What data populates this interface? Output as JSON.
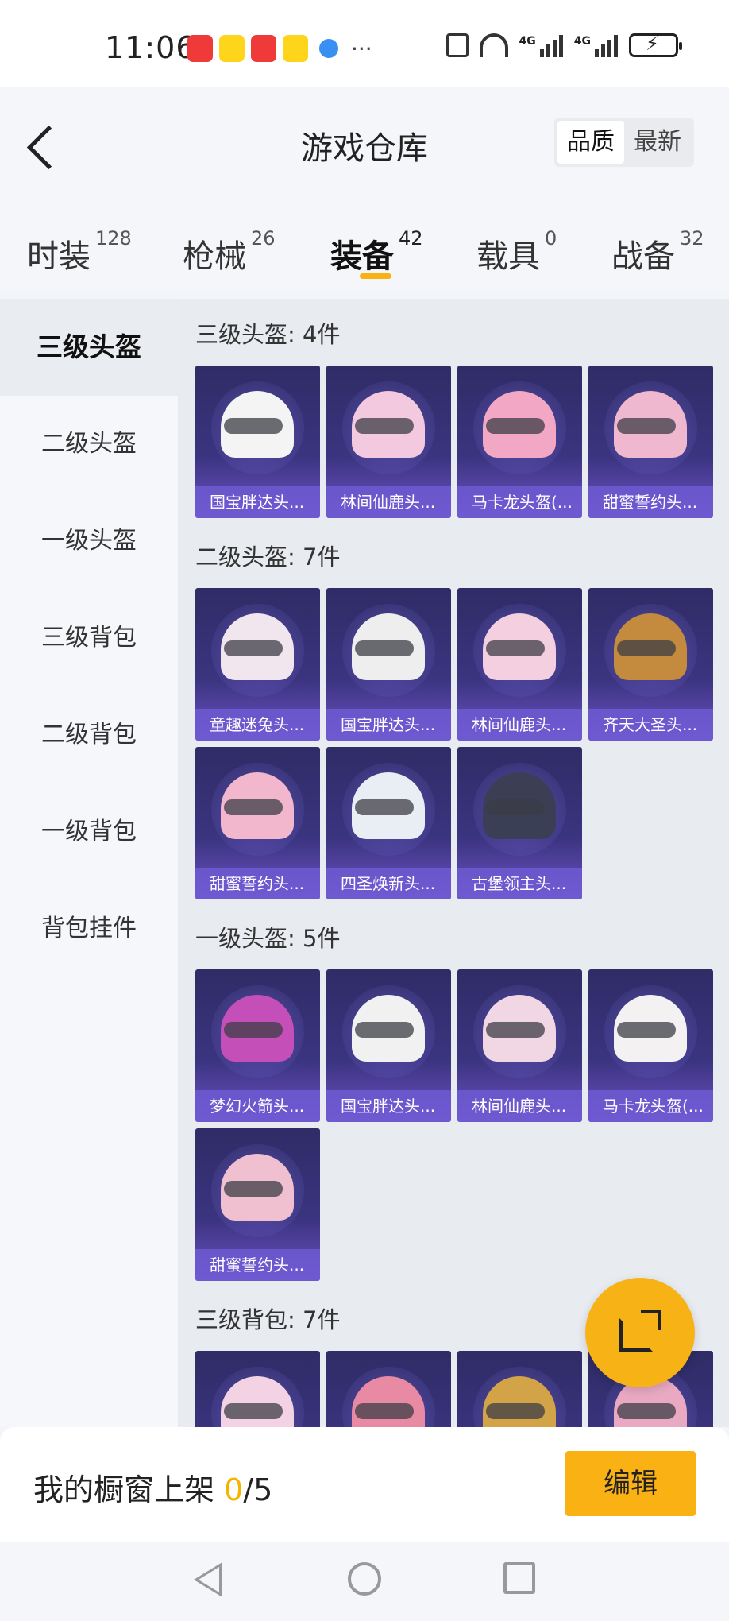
{
  "status_bar": {
    "time": "11:06",
    "network_labels": [
      "4G",
      "4G"
    ]
  },
  "header": {
    "title": "游戏仓库",
    "sort_options": [
      "品质",
      "最新"
    ],
    "tabs": [
      {
        "label": "时装",
        "count": "128"
      },
      {
        "label": "枪械",
        "count": "26"
      },
      {
        "label": "装备",
        "count": "42"
      },
      {
        "label": "载具",
        "count": "0"
      },
      {
        "label": "战备",
        "count": "32"
      }
    ]
  },
  "sidebar": {
    "items": [
      {
        "label": "三级头盔"
      },
      {
        "label": "二级头盔"
      },
      {
        "label": "一级头盔"
      },
      {
        "label": "三级背包"
      },
      {
        "label": "二级背包"
      },
      {
        "label": "一级背包"
      },
      {
        "label": "背包挂件"
      }
    ]
  },
  "sections": [
    {
      "title": "三级头盔: 4件",
      "items": [
        {
          "name": "国宝胖达头...",
          "color": "#f4f4f4"
        },
        {
          "name": "林间仙鹿头...",
          "color": "#f3c9df"
        },
        {
          "name": "马卡龙头盔(...",
          "color": "#f2a8c4"
        },
        {
          "name": "甜蜜誓约头...",
          "color": "#f0b8cf"
        }
      ]
    },
    {
      "title": "二级头盔: 7件",
      "items": [
        {
          "name": "童趣迷兔头...",
          "color": "#f2e6ee"
        },
        {
          "name": "国宝胖达头...",
          "color": "#eeeeee"
        },
        {
          "name": "林间仙鹿头...",
          "color": "#f3cfe0"
        },
        {
          "name": "齐天大圣头...",
          "color": "#c48a3e"
        },
        {
          "name": "甜蜜誓约头...",
          "color": "#f2b7cd"
        },
        {
          "name": "四圣焕新头...",
          "color": "#e9edf4"
        },
        {
          "name": "古堡领主头...",
          "color": "#3a3f56"
        }
      ]
    },
    {
      "title": "一级头盔: 5件",
      "items": [
        {
          "name": "梦幻火箭头...",
          "color": "#c54fb8"
        },
        {
          "name": "国宝胖达头...",
          "color": "#f1f1f1"
        },
        {
          "name": "林间仙鹿头...",
          "color": "#f1d7e3"
        },
        {
          "name": "马卡龙头盔(...",
          "color": "#f4f1f3"
        },
        {
          "name": "甜蜜誓约头...",
          "color": "#f0bfd0"
        }
      ]
    },
    {
      "title": "三级背包: 7件",
      "items": [
        {
          "name": "",
          "color": "#f3d3e3"
        },
        {
          "name": "",
          "color": "#e98aa4"
        },
        {
          "name": "",
          "color": "#d3a347"
        },
        {
          "name": "",
          "color": "#eaa9c3"
        }
      ]
    }
  ],
  "bottom_bar": {
    "label": "我的橱窗上架 ",
    "count": "0",
    "total": "/5",
    "edit_label": "编辑"
  }
}
